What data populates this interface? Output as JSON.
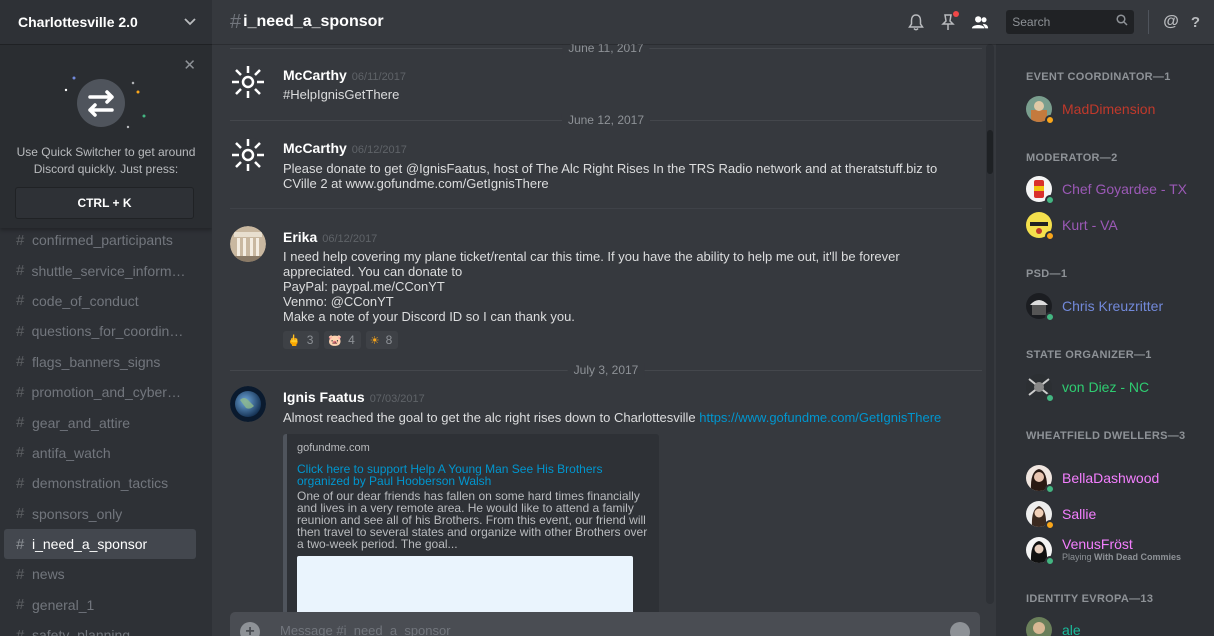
{
  "server": {
    "name": "Charlottesville 2.0"
  },
  "quick_switcher": {
    "text": "Use Quick Switcher to get around Discord quickly. Just press:",
    "shortcut": "CTRL + K"
  },
  "channels": [
    "confirmed_participants",
    "shuttle_service_informat...",
    "code_of_conduct",
    "questions_for_coordinat...",
    "flags_banners_signs",
    "promotion_and_cyberstr...",
    "gear_and_attire",
    "antifa_watch",
    "demonstration_tactics",
    "sponsors_only",
    "i_need_a_sponsor",
    "news",
    "general_1",
    "safety_planning"
  ],
  "active_channel": "i_need_a_sponsor",
  "topbar": {
    "hash": "#",
    "channel_title": "i_need_a_sponsor",
    "search_placeholder": "Search",
    "at": "@",
    "help": "?"
  },
  "messages": {
    "date_top": "June 11, 2017",
    "m1": {
      "author": "McCarthy",
      "time": "06/11/2017",
      "text": "#HelpIgnisGetThere"
    },
    "date_2": "June 12, 2017",
    "m2": {
      "author": "McCarthy",
      "time": "06/12/2017",
      "text": "Please donate to get @IgnisFaatus, host of The Alc Right Rises In the TRS Radio network and at theratstuff.biz to CVille 2 at www.gofundme.com/GetIgnisThere"
    },
    "m3": {
      "author": "Erika",
      "time": "06/12/2017",
      "lines": [
        "I need help covering my plane ticket/rental car this time. If you have the ability to help me out, it'll be forever appreciated. You can donate to",
        "PayPal: paypal.me/CConYT",
        "Venmo: @CConYT",
        "Make a note of your Discord ID so I can thank you."
      ],
      "reactions": [
        {
          "emoji": "🖕",
          "count": "3"
        },
        {
          "emoji": "🐷",
          "count": "4"
        },
        {
          "emoji": "☀",
          "count": "8"
        }
      ]
    },
    "date_3": "July 3, 2017",
    "m4": {
      "author": "Ignis Faatus",
      "time": "07/03/2017",
      "text": "Almost reached the goal to get the alc right  rises down to Charlottesville",
      "link": "https://www.gofundme.com/GetIgnisThere",
      "embed": {
        "provider": "gofundme.com",
        "title": "Click here to support Help A Young Man See His Brothers organized by Paul Hooberson Walsh",
        "description": "One of our dear friends has fallen on some hard times financially and lives in a very remote area. He would like to attend a family reunion and see all of his Brothers. From this event, our friend will then travel to several states and organize with other Brothers over a two-week period. The goal..."
      }
    }
  },
  "composer": {
    "placeholder": "Message #i_need_a_sponsor"
  },
  "members": {
    "roles": [
      {
        "title": "EVENT COORDINATOR—1"
      },
      {
        "title": "MODERATOR—2"
      },
      {
        "title": "PSD—1"
      },
      {
        "title": "STATE ORGANIZER—1"
      },
      {
        "title": "WHEATFIELD DWELLERS—3"
      },
      {
        "title": "IDENTITY EVROPA—13"
      }
    ],
    "list": [
      {
        "name": "MadDimension",
        "color": "#c0392b",
        "status": "#faa61a"
      },
      {
        "name": "Chef Goyardee - TX",
        "color": "#9b59b6",
        "status": "#43b581"
      },
      {
        "name": "Kurt - VA",
        "color": "#9b59b6",
        "status": "#faa61a"
      },
      {
        "name": "Chris Kreuzritter",
        "color": "#7289da",
        "status": "#43b581"
      },
      {
        "name": "von Diez - NC",
        "color": "#2ecc71",
        "status": "#43b581"
      },
      {
        "name": "BellaDashwood",
        "color": "#f47fff",
        "status": "#43b581"
      },
      {
        "name": "Sallie",
        "color": "#f47fff",
        "status": "#faa61a"
      },
      {
        "name": "VenusFröst",
        "color": "#f47fff",
        "status": "#43b581",
        "playing_prefix": "Playing",
        "playing_game": "With Dead Commies"
      },
      {
        "name": "ale",
        "color": "#1abc9c",
        "status": "#43b581"
      }
    ]
  }
}
